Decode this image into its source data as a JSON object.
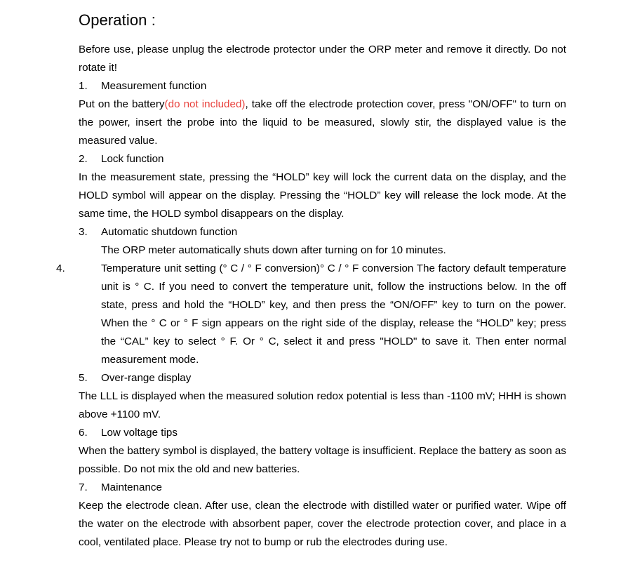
{
  "document": {
    "title": "Operation :",
    "intro": "Before use, please unplug the electrode protector under the ORP meter and remove it directly. Do not rotate it!",
    "red_note": "(do not included)",
    "sections": [
      {
        "number": "1.",
        "heading": "Measurement function",
        "body_pre_red": "Put on the battery",
        "body_post_red": ", take off the electrode protection cover, press \"ON/OFF\" to turn on the power, insert the probe into the liquid to be measured, slowly stir, the displayed value is the measured value."
      },
      {
        "number": "2.",
        "heading": "Lock function",
        "body": "In the measurement state, pressing the “HOLD” key will lock the current data on the display, and the HOLD symbol will appear on the display. Pressing the “HOLD” key will release the lock mode. At the same time, the HOLD symbol disappears on the display."
      },
      {
        "number": "3.",
        "heading": "Automatic shutdown function",
        "body": "The ORP meter automatically shuts down after turning on for 10 minutes."
      },
      {
        "number": "4.",
        "heading_inline": "Temperature unit setting (° C / ° F conversion)° C / ° F conversion The factory default temperature unit is ° C. If you need to convert the temperature unit, follow the instructions below. In the off state, press and hold the “HOLD” key, and then press the “ON/OFF” key to turn on the power. When the ° C or ° F sign appears on the right side of the display, release the “HOLD” key; press the “CAL” key to select ° F. Or ° C, select it and press \"HOLD\" to save it. Then enter normal measurement mode."
      },
      {
        "number": "5.",
        "heading": "Over-range display",
        "body": "The LLL is displayed when the measured solution redox potential is less than -1100 mV; HHH is shown above +1100 mV."
      },
      {
        "number": "6.",
        "heading": "Low voltage tips",
        "body": "When the battery symbol is displayed, the battery voltage is insufficient. Replace the battery as soon as possible. Do not mix the old and new batteries."
      },
      {
        "number": "7.",
        "heading": "Maintenance",
        "body": "Keep the electrode clean. After use, clean the electrode with distilled water or purified water. Wipe off the water on the electrode with absorbent paper, cover the electrode protection cover, and place in a cool, ventilated place. Please try not to bump or rub the electrodes during use."
      }
    ],
    "colors": {
      "text": "#000000",
      "accent_red": "#e8413c",
      "background": "#ffffff"
    }
  }
}
